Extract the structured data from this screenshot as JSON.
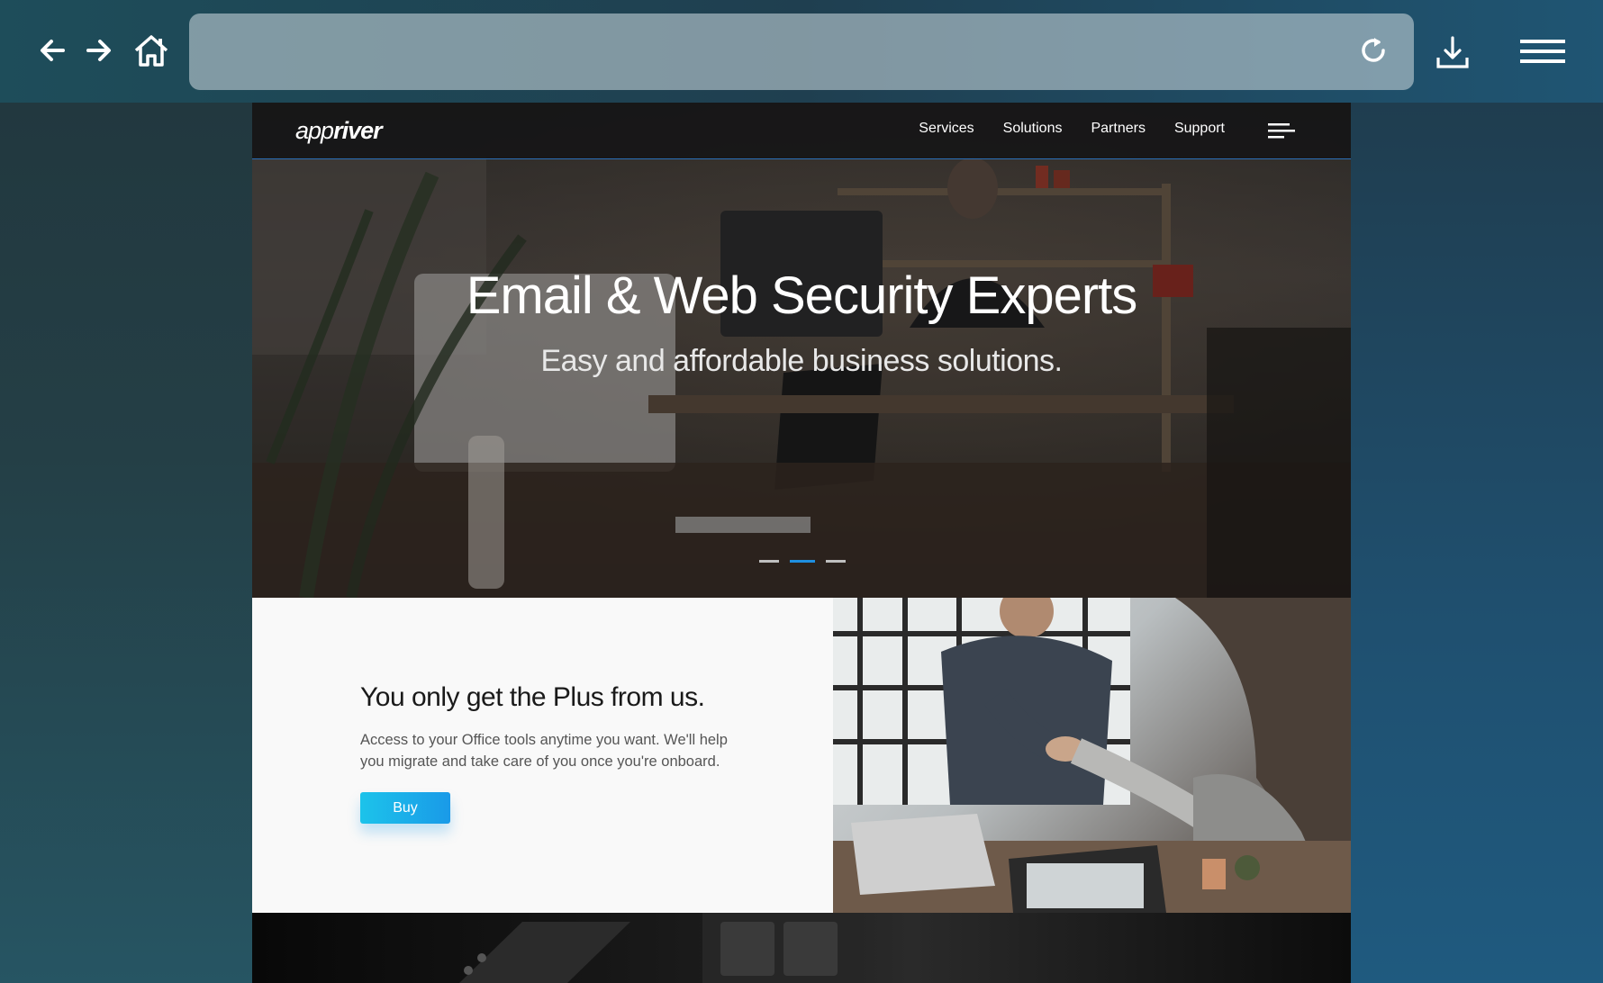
{
  "browser": {
    "back_icon": "arrow-left-icon",
    "forward_icon": "arrow-right-icon",
    "home_icon": "home-icon",
    "address_value": "",
    "reload_icon": "reload-icon",
    "download_icon": "download-icon",
    "menu_icon": "hamburger-menu-icon"
  },
  "site": {
    "logo": {
      "light": "app",
      "bold": "river"
    },
    "nav": [
      "Services",
      "Solutions",
      "Partners",
      "Support"
    ],
    "nav_menu_icon": "menu-lines-icon",
    "hero": {
      "title": "Email & Web Security Experts",
      "subtitle": "Easy and affordable business solutions.",
      "slides": 3,
      "active_slide": 2
    },
    "plus": {
      "heading": "You only get the Plus from us.",
      "body": "Access to your Office tools anytime you want. We'll help you migrate and take care of you once you're onboard.",
      "buy_label": "Buy"
    }
  },
  "colors": {
    "accent": "#1e8fe0",
    "button_start": "#1cc3ea",
    "button_end": "#1a9ae8"
  }
}
